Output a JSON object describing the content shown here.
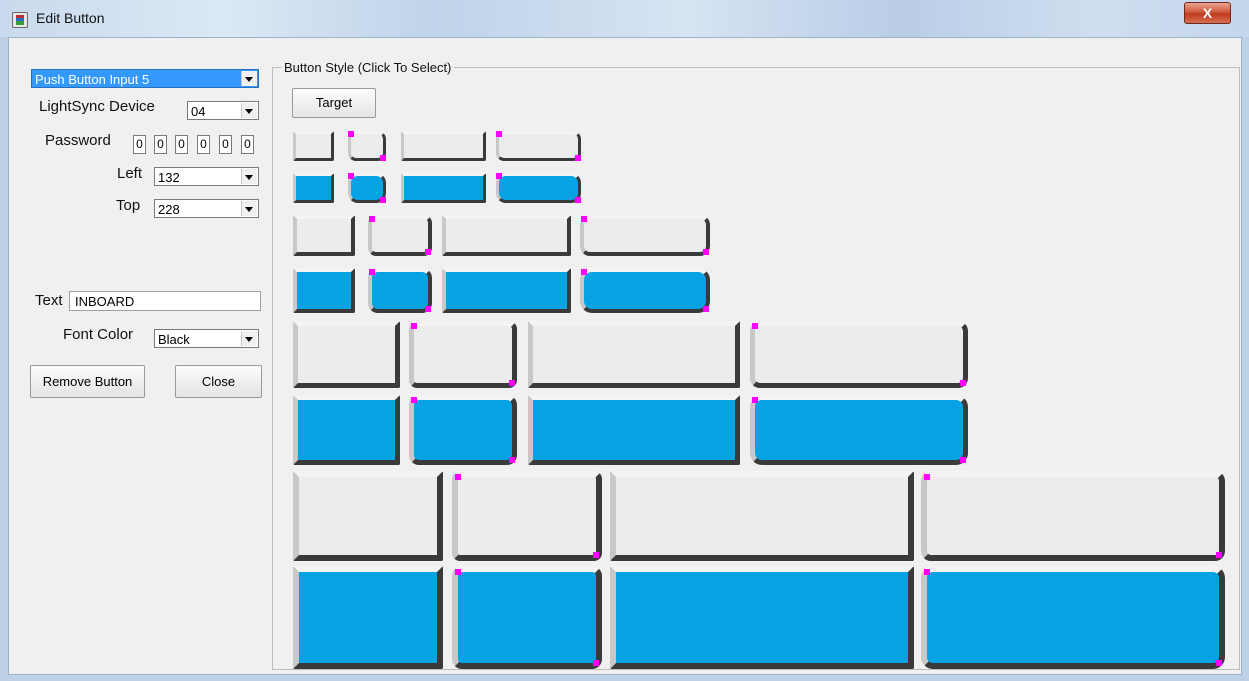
{
  "window": {
    "title": "Edit Button",
    "close_glyph": "X"
  },
  "form": {
    "input_select": "Push Button Input 5",
    "device_label": "LightSync Device",
    "device_value": "04",
    "password_label": "Password",
    "password_digits": [
      "0",
      "0",
      "0",
      "0",
      "0",
      "0"
    ],
    "left_label": "Left",
    "left_value": "132",
    "top_label": "Top",
    "top_value": "228",
    "text_label": "Text",
    "text_value": "INBOARD",
    "font_color_label": "Font Color",
    "font_color_value": "Black",
    "remove_label": "Remove Button",
    "close_label": "Close"
  },
  "styles": {
    "legend": "Button Style (Click To Select)",
    "target_label": "Target"
  },
  "colors": {
    "swatch_fill_blue": "#06a3e4",
    "swatch_fill_gray": "#ececec",
    "corner_marker": "#ff00ff"
  }
}
